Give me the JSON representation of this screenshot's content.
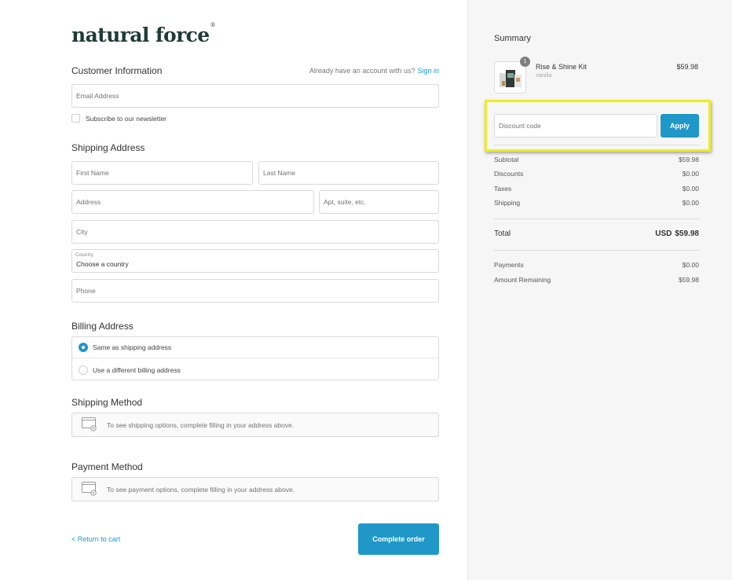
{
  "brand": {
    "logo_text": "natural force",
    "logo_mark": "®"
  },
  "customer": {
    "title": "Customer Information",
    "account_note": "Already have an account with us?",
    "sign_in": "Sign in",
    "email_placeholder": "Email Address",
    "newsletter_label": "Subscribe to our newsletter"
  },
  "shipping": {
    "title": "Shipping Address",
    "first_name": "First Name",
    "last_name": "Last Name",
    "address": "Address",
    "apt": "Apt, suite, etc.",
    "city": "City",
    "country_label": "Country",
    "country_value": "Choose a country",
    "phone": "Phone"
  },
  "billing": {
    "title": "Billing Address",
    "option_same": "Same as shipping address",
    "option_different": "Use a different billing address",
    "selected": "same"
  },
  "shipping_method": {
    "title": "Shipping Method",
    "message": "To see shipping options, complete filling in your address above."
  },
  "payment_method": {
    "title": "Payment Method",
    "message": "To see payment options, complete filling in your address above."
  },
  "footer": {
    "return_link": "< Return to cart",
    "complete_button": "Complete order"
  },
  "summary": {
    "title": "Summary",
    "product": {
      "name": "Rise & Shine Kit",
      "variant": "Vanilla",
      "price": "$59.98",
      "quantity": "1"
    },
    "discount_placeholder": "Discount code",
    "apply_button": "Apply",
    "lines": [
      {
        "label": "Subtotal",
        "value": "$59.98"
      },
      {
        "label": "Discounts",
        "value": "$0.00"
      },
      {
        "label": "Taxes",
        "value": "$0.00"
      },
      {
        "label": "Shipping",
        "value": "$0.00"
      }
    ],
    "total": {
      "label": "Total",
      "currency": "USD",
      "value": "$59.98"
    },
    "payments": {
      "label": "Payments",
      "value": "$0.00"
    },
    "remaining": {
      "label": "Amount Remaining",
      "value": "$59.98"
    }
  },
  "colors": {
    "accent": "#1f98c7",
    "brand": "#1f3b34",
    "highlight": "#eeee1e",
    "sidebar_bg": "#f6f6f6"
  }
}
